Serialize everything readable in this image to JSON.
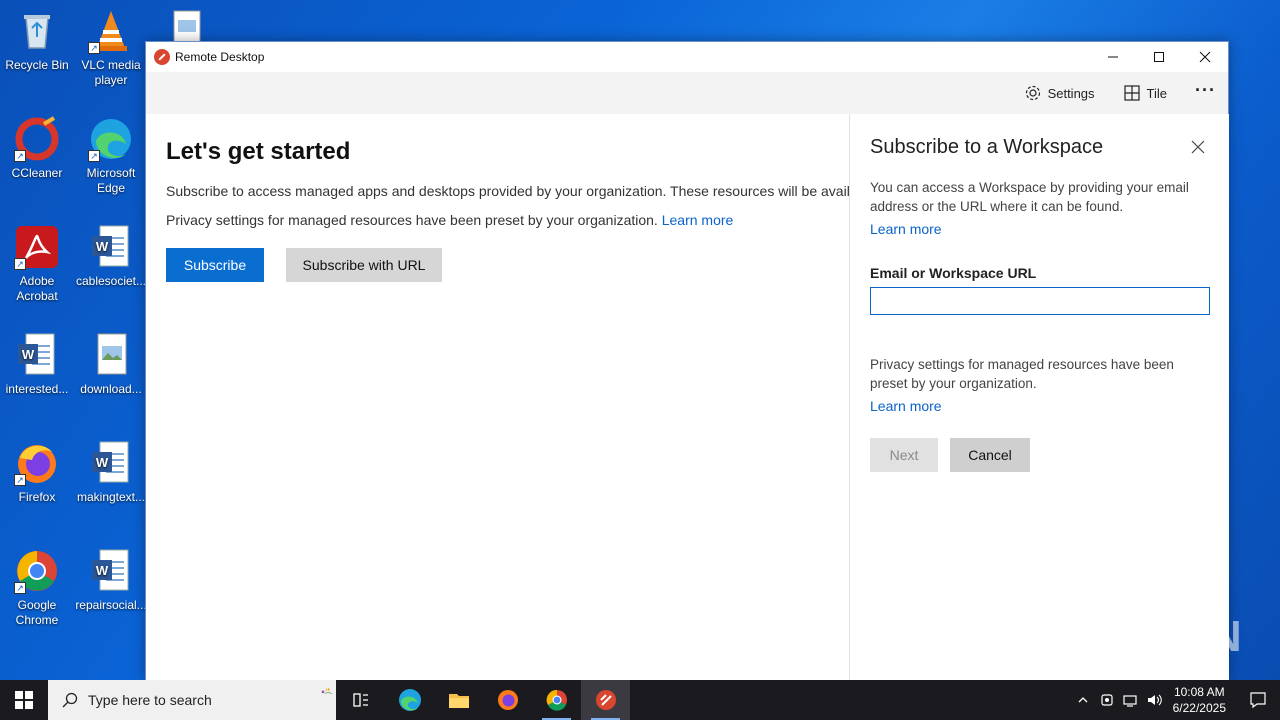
{
  "desktop": {
    "icons": [
      {
        "label": "Recycle Bin",
        "icon": "recycle-bin-icon"
      },
      {
        "label": "VLC media player",
        "icon": "vlc-icon"
      },
      {
        "label": "CCleaner",
        "icon": "ccleaner-icon"
      },
      {
        "label": "Microsoft Edge",
        "icon": "edge-icon"
      },
      {
        "label": "Adobe Acrobat",
        "icon": "acrobat-icon"
      },
      {
        "label": "cablesociet...",
        "icon": "word-doc-icon"
      },
      {
        "label": "interested...",
        "icon": "word-doc-icon"
      },
      {
        "label": "download...",
        "icon": "image-file-icon"
      },
      {
        "label": "Firefox",
        "icon": "firefox-icon"
      },
      {
        "label": "makingtext...",
        "icon": "word-doc-icon"
      },
      {
        "label": "Google Chrome",
        "icon": "chrome-icon"
      },
      {
        "label": "repairsocial...",
        "icon": "word-doc-icon"
      }
    ]
  },
  "window": {
    "title": "Remote Desktop",
    "toolbar": {
      "settings_label": "Settings",
      "tile_label": "Tile",
      "more_label": "···"
    }
  },
  "main": {
    "title": "Let's get started",
    "description": "Subscribe to access managed apps and desktops provided by your organization. These resources will be available",
    "privacy_text": "Privacy settings for managed resources have been preset by your organization.",
    "learn_more": "Learn more",
    "subscribe_label": "Subscribe",
    "subscribe_url_label": "Subscribe with URL"
  },
  "side_panel": {
    "title": "Subscribe to a Workspace",
    "description": "You can access a Workspace by providing your email address or the URL where it can be found.",
    "learn_more_1": "Learn more",
    "field_label": "Email or Workspace URL",
    "field_value": "",
    "privacy_text": "Privacy settings for managed resources have been preset by your organization.",
    "learn_more_2": "Learn more",
    "next_label": "Next",
    "cancel_label": "Cancel"
  },
  "watermark": "ANY RUN",
  "taskbar": {
    "search_placeholder": "Type here to search",
    "time": "10:08 AM",
    "date": "6/22/2025"
  },
  "colors": {
    "accent": "#0a6ed1",
    "link": "#0a64c9",
    "taskbar": "#1b1b1f"
  }
}
